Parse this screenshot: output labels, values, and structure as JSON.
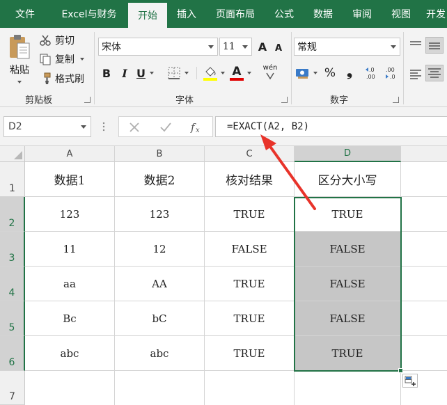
{
  "menubar": {
    "tabs": [
      {
        "label": "文件",
        "active": false
      },
      {
        "label": "Excel与财务",
        "active": false
      },
      {
        "label": "开始",
        "active": true
      },
      {
        "label": "插入",
        "active": false
      },
      {
        "label": "页面布局",
        "active": false
      },
      {
        "label": "公式",
        "active": false
      },
      {
        "label": "数据",
        "active": false
      },
      {
        "label": "审阅",
        "active": false
      },
      {
        "label": "视图",
        "active": false
      },
      {
        "label": "开发",
        "active": false
      }
    ]
  },
  "ribbon": {
    "clipboard": {
      "paste_label": "粘贴",
      "cut_label": "剪切",
      "copy_label": "复制",
      "format_painter_label": "格式刷",
      "group_label": "剪贴板"
    },
    "font": {
      "font_name": "宋体",
      "font_size": "11",
      "grow_label": "A",
      "shrink_label": "A",
      "bold_label": "B",
      "italic_label": "I",
      "underline_label": "U",
      "font_color_label": "A",
      "phonetic_label": "wén",
      "group_label": "字体",
      "highlight_color": "#ffff00",
      "font_color": "#e00000"
    },
    "number": {
      "format": "常规",
      "percent_label": "%",
      "comma_label": "❟",
      "group_label": "数字"
    }
  },
  "formula_bar": {
    "name_box": "D2",
    "formula": "=EXACT(A2, B2)"
  },
  "grid": {
    "columns": [
      "A",
      "B",
      "C",
      "D"
    ],
    "rows": [
      "1",
      "2",
      "3",
      "4",
      "5",
      "6",
      "7"
    ],
    "header_row": [
      "数据1",
      "数据2",
      "核对结果",
      "区分大小写"
    ],
    "data": [
      [
        "123",
        "123",
        "TRUE",
        "TRUE"
      ],
      [
        "11",
        "12",
        "FALSE",
        "FALSE"
      ],
      [
        "aa",
        "AA",
        "TRUE",
        "FALSE"
      ],
      [
        "Bc",
        "bC",
        "TRUE",
        "FALSE"
      ],
      [
        "abc",
        "abc",
        "TRUE",
        "TRUE"
      ]
    ]
  },
  "colors": {
    "accent": "#217346",
    "annotation_arrow": "#e8332a"
  }
}
